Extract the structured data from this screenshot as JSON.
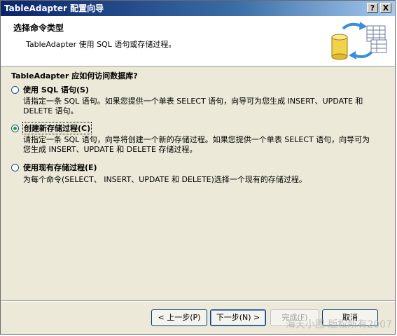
{
  "window": {
    "title": "TableAdapter 配置向导",
    "help_glyph": "?",
    "close_glyph": "X"
  },
  "header": {
    "title": "选择命令类型",
    "description": "TableAdapter 使用 SQL 语句或存储过程。",
    "icon": "database-command-icon"
  },
  "content": {
    "question": "TableAdapter 应如何访问数据库?",
    "options": [
      {
        "label": "使用 SQL 语句(S)",
        "selected": false,
        "description": "请指定一条 SQL 语句。如果您提供一个单表 SELECT 语句，向导可为您生成 INSERT、UPDATE 和 DELETE 语句。"
      },
      {
        "label": "创建新存储过程(C)",
        "selected": true,
        "description": "请指定一条 SQL 语句，向导将创建一个新的存储过程。如果您提供一个单表 SELECT 语句，向导可为您生成 INSERT、UPDATE 和 DELETE 存储过程。"
      },
      {
        "label": "使用现有存储过程(E)",
        "selected": false,
        "description": "为每个命令(SELECT、 INSERT、UPDATE 和 DELETE)选择一个现有的存储过程。"
      }
    ]
  },
  "buttons": {
    "back": "< 上一步(P)",
    "next": "下一步(N) >",
    "finish": "完成(F)",
    "cancel": "取消"
  },
  "watermark": "海天小图 版权所有2007"
}
